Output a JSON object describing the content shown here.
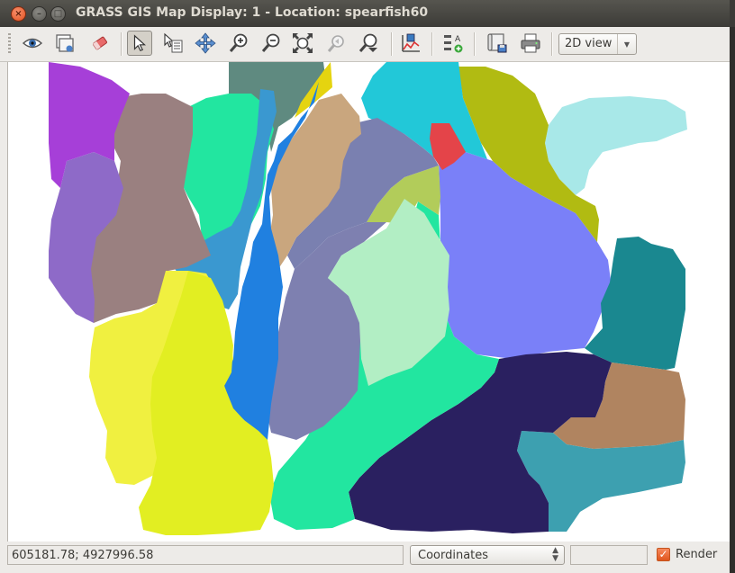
{
  "window": {
    "title": "GRASS GIS Map Display: 1  - Location: spearfish60",
    "buttons": {
      "close": "×",
      "minimize": "–",
      "maximize": "□"
    }
  },
  "toolbar": {
    "tools": [
      {
        "name": "display-map-icon"
      },
      {
        "name": "render-map-icon"
      },
      {
        "name": "erase-display-icon"
      },
      {
        "name": "pointer-icon",
        "active": true
      },
      {
        "name": "query-icon"
      },
      {
        "name": "pan-icon"
      },
      {
        "name": "zoom-in-icon"
      },
      {
        "name": "zoom-out-icon"
      },
      {
        "name": "zoom-extent-icon"
      },
      {
        "name": "zoom-back-icon"
      },
      {
        "name": "zoom-menu-icon"
      },
      {
        "name": "analyze-icon"
      },
      {
        "name": "overlay-icon"
      },
      {
        "name": "save-icon"
      },
      {
        "name": "print-icon"
      }
    ],
    "view_mode": "2D view"
  },
  "statusbar": {
    "coordinates": "605181.78; 4927996.58",
    "mode": "Coordinates",
    "render_label": "Render",
    "render_checked": true
  },
  "colors": {
    "region_purple": "#a63fd8",
    "region_teal_gray": "#5f8a80",
    "region_cyan": "#22c8d8",
    "region_olive": "#b1bb12",
    "region_light_cyan": "#a8e8e8",
    "region_mint": "#22e6a0",
    "region_tan": "#c9a67e",
    "region_slate": "#7e80b0",
    "region_red": "#e44449",
    "region_periwinkle": "#7a80f8",
    "region_yellow": "#eef040",
    "region_light_green": "#b2eec4",
    "region_navy": "#2a2060",
    "region_brown": "#b08460",
    "region_steel": "#3da0b0",
    "region_dark_teal": "#1a8890"
  }
}
